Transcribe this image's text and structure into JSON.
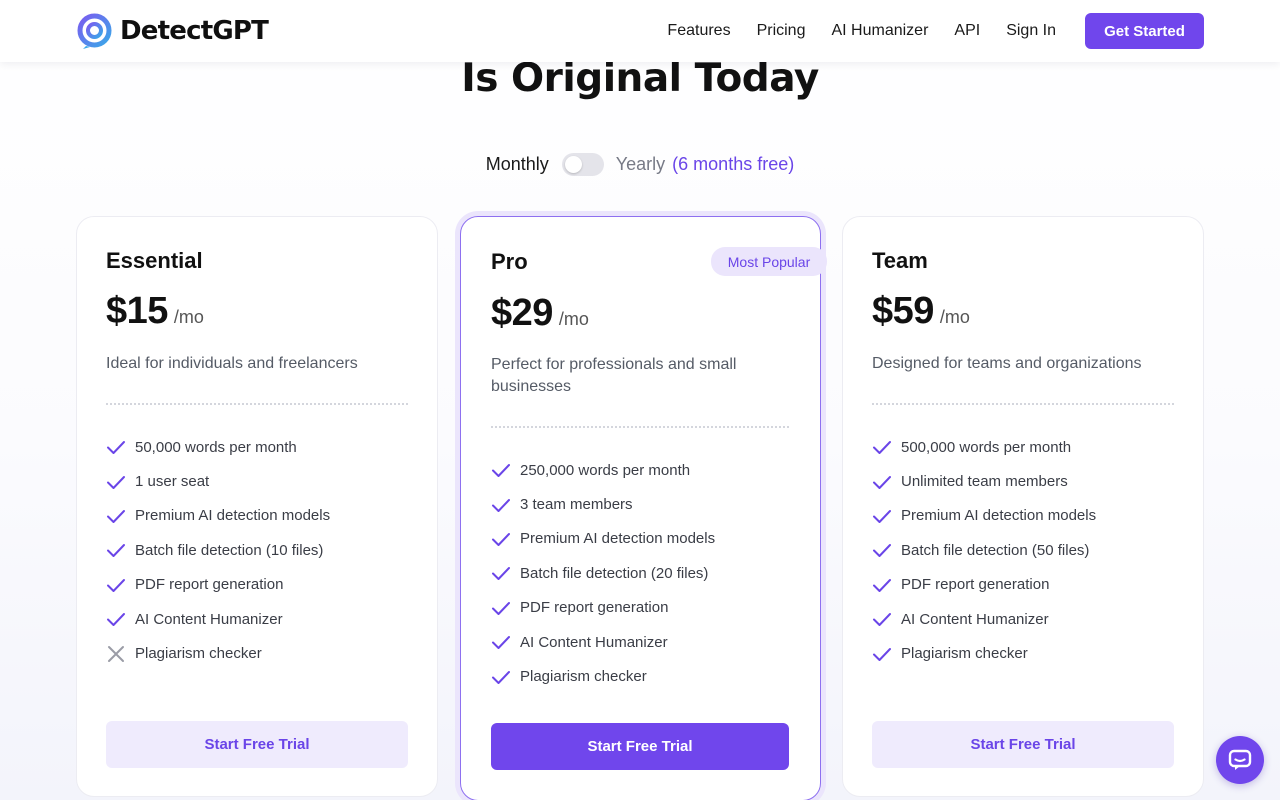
{
  "brand": {
    "name": "DetectGPT",
    "accent": "#7046ec"
  },
  "nav": {
    "links": [
      "Features",
      "Pricing",
      "AI Humanizer",
      "API",
      "Sign In"
    ],
    "cta": "Get Started"
  },
  "hero": {
    "headline_visible": "Is Original Today"
  },
  "billing": {
    "monthly_label": "Monthly",
    "yearly_label": "Yearly",
    "yearly_promo": "(6 months free)",
    "yearly_selected": false
  },
  "plans": [
    {
      "name": "Essential",
      "price": "$15",
      "period": "/mo",
      "description": "Ideal for individuals and freelancers",
      "features": [
        {
          "label": "50,000 words per month",
          "included": true
        },
        {
          "label": "1 user seat",
          "included": true
        },
        {
          "label": "Premium AI detection models",
          "included": true
        },
        {
          "label": "Batch file detection (10 files)",
          "included": true
        },
        {
          "label": "PDF report generation",
          "included": true
        },
        {
          "label": "AI Content Humanizer",
          "included": true
        },
        {
          "label": "Plagiarism checker",
          "included": false
        }
      ],
      "cta": "Start Free Trial"
    },
    {
      "name": "Pro",
      "badge": "Most Popular",
      "price": "$29",
      "period": "/mo",
      "description": "Perfect for professionals and small businesses",
      "features": [
        {
          "label": "250,000 words per month",
          "included": true
        },
        {
          "label": "3 team members",
          "included": true
        },
        {
          "label": "Premium AI detection models",
          "included": true
        },
        {
          "label": "Batch file detection (20 files)",
          "included": true
        },
        {
          "label": "PDF report generation",
          "included": true
        },
        {
          "label": "AI Content Humanizer",
          "included": true
        },
        {
          "label": "Plagiarism checker",
          "included": true
        }
      ],
      "cta": "Start Free Trial"
    },
    {
      "name": "Team",
      "price": "$59",
      "period": "/mo",
      "description": "Designed for teams and organizations",
      "features": [
        {
          "label": "500,000 words per month",
          "included": true
        },
        {
          "label": "Unlimited team members",
          "included": true
        },
        {
          "label": "Premium AI detection models",
          "included": true
        },
        {
          "label": "Batch file detection (50 files)",
          "included": true
        },
        {
          "label": "PDF report generation",
          "included": true
        },
        {
          "label": "AI Content Humanizer",
          "included": true
        },
        {
          "label": "Plagiarism checker",
          "included": true
        }
      ],
      "cta": "Start Free Trial"
    }
  ],
  "icons": {
    "included": "check-icon",
    "excluded": "x-icon",
    "chat": "chat-bubble-icon"
  }
}
